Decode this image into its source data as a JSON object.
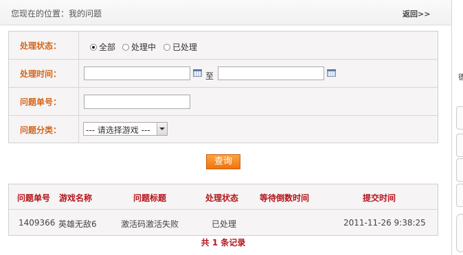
{
  "breadcrumb": "您现在的位置：我的问题",
  "back_link": "返回>>",
  "filters": {
    "status_label": "处理状态：",
    "status_options": [
      {
        "label": "全部",
        "checked": true
      },
      {
        "label": "处理中",
        "checked": false
      },
      {
        "label": "已处理",
        "checked": false
      }
    ],
    "time_label": "处理时间：",
    "time_to": "至",
    "ticket_label": "问题单号：",
    "category_label": "问题分类：",
    "category_selected": "--- 请选择游戏 ---"
  },
  "query_button": "查询",
  "table": {
    "headers": [
      "问题单号",
      "游戏名称",
      "问题标题",
      "处理状态",
      "等待倒数时间",
      "提交时间"
    ],
    "rows": [
      [
        "1409366",
        "英雄无敌6",
        "激活码激活失败",
        "已处理",
        "",
        "2011-11-26 9:38:25"
      ]
    ]
  },
  "total": {
    "prefix": "共",
    "count": "1",
    "suffix": "条记录"
  },
  "sidebar_glyph": "德"
}
